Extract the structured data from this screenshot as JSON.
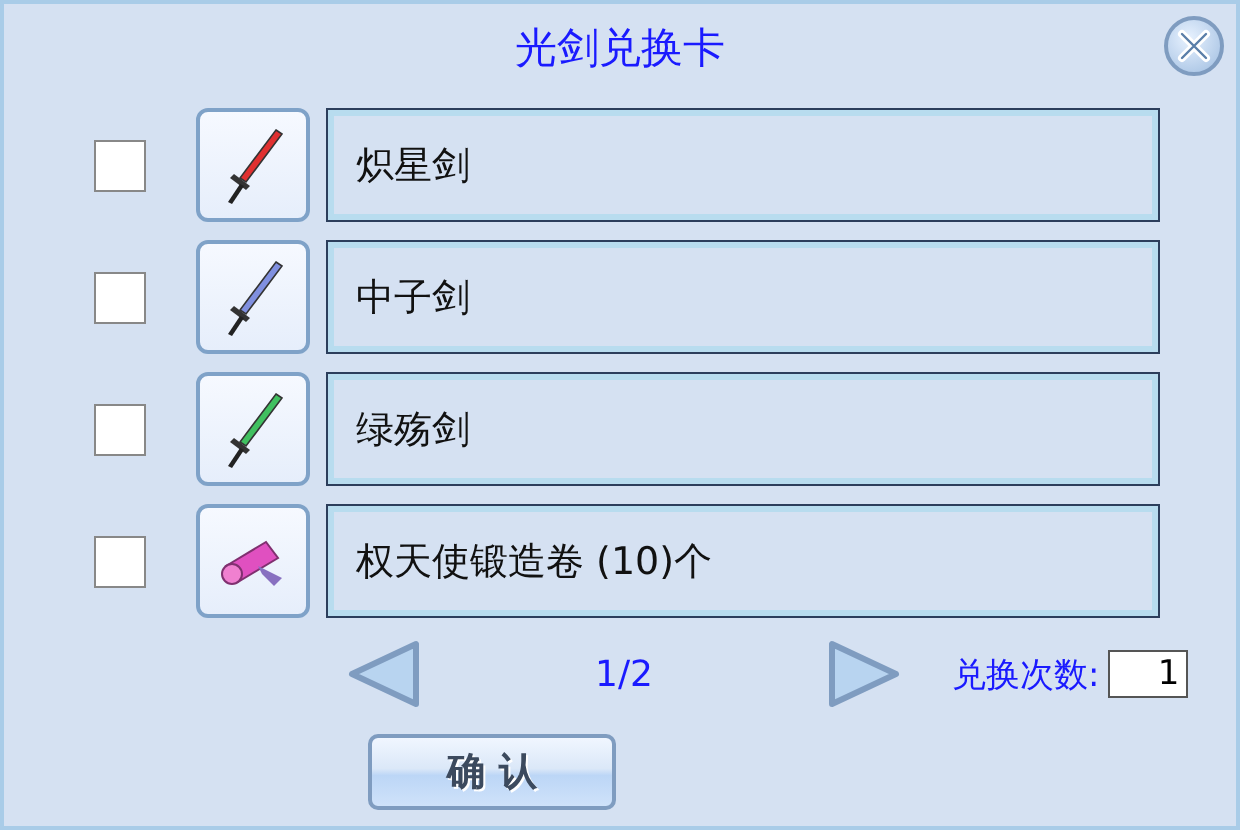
{
  "window": {
    "title": "光剑兑换卡"
  },
  "items": [
    {
      "name": "炽星剑",
      "kind": "sword",
      "color": "#e03030",
      "checked": false
    },
    {
      "name": "中子剑",
      "kind": "sword",
      "color": "#8090e0",
      "checked": false
    },
    {
      "name": "绿殇剑",
      "kind": "sword",
      "color": "#40c060",
      "checked": false
    },
    {
      "name": "权天使锻造卷 (10)个",
      "kind": "scroll",
      "checked": false
    }
  ],
  "pager": {
    "page": "1/2"
  },
  "exchange": {
    "label": "兑换次数:",
    "value": "1"
  },
  "buttons": [
    "确 认"
  ]
}
